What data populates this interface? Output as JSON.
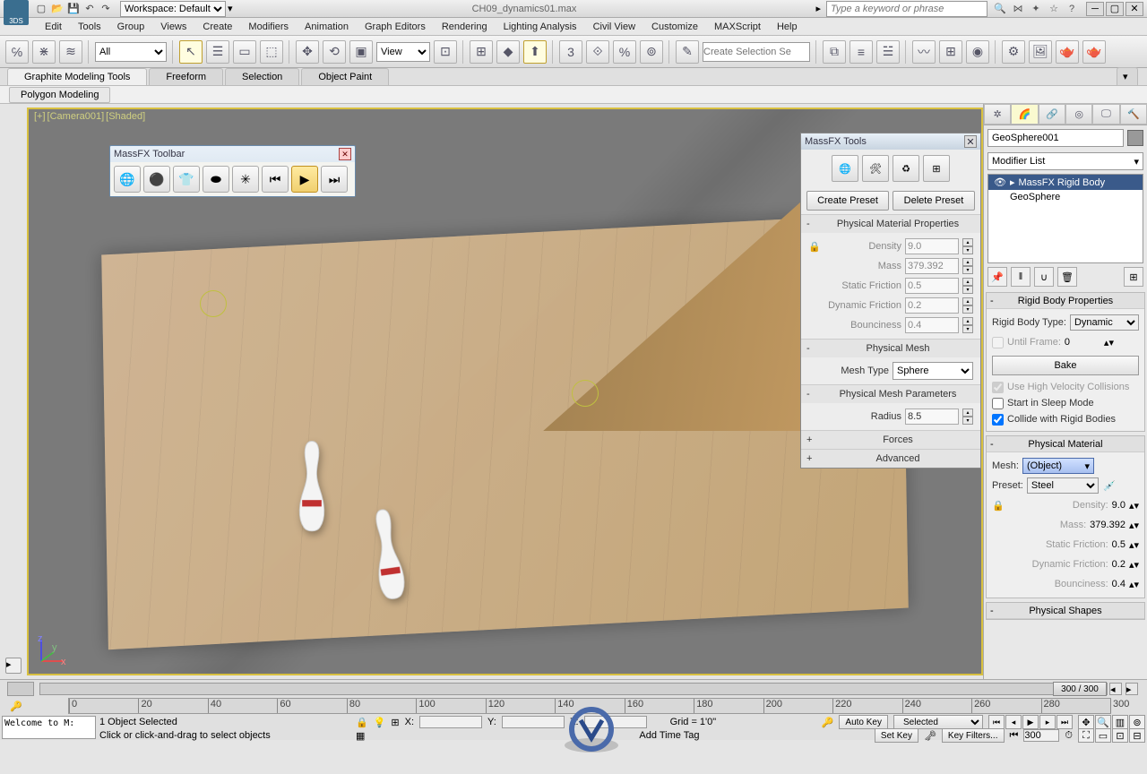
{
  "title": "CH09_dynamics01.max",
  "workspace_label": "Workspace: Default",
  "search_placeholder": "Type a keyword or phrase",
  "menu": [
    "Edit",
    "Tools",
    "Group",
    "Views",
    "Create",
    "Modifiers",
    "Animation",
    "Graph Editors",
    "Rendering",
    "Lighting Analysis",
    "Civil View",
    "Customize",
    "MAXScript",
    "Help"
  ],
  "toolbar": {
    "filter_dd": "All",
    "refsys_dd": "View",
    "selset_placeholder": "Create Selection Se"
  },
  "ribbon_tabs": [
    "Graphite Modeling Tools",
    "Freeform",
    "Selection",
    "Object Paint"
  ],
  "ribbon_sub": "Polygon Modeling",
  "viewport_label": [
    "[+]",
    "[Camera001]",
    "[Shaded]"
  ],
  "fx_toolbar_title": "MassFX Toolbar",
  "fx_panel": {
    "title": "MassFX Tools",
    "create_preset": "Create Preset",
    "delete_preset": "Delete Preset",
    "sec_pmp": "Physical Material Properties",
    "density_l": "Density",
    "density_v": "9.0",
    "mass_l": "Mass",
    "mass_v": "379.392",
    "sfric_l": "Static Friction",
    "sfric_v": "0.5",
    "dfric_l": "Dynamic Friction",
    "dfric_v": "0.2",
    "bounce_l": "Bounciness",
    "bounce_v": "0.4",
    "sec_pm": "Physical Mesh",
    "meshtype_l": "Mesh Type",
    "meshtype_v": "Sphere",
    "sec_pmparam": "Physical Mesh Parameters",
    "radius_l": "Radius",
    "radius_v": "8.5",
    "sec_forces": "Forces",
    "sec_adv": "Advanced"
  },
  "cmd": {
    "obj_name": "GeoSphere001",
    "modlist": "Modifier List",
    "stack": [
      "MassFX Rigid Body",
      "GeoSphere"
    ],
    "ru_rbp": "Rigid Body Properties",
    "rbtype_l": "Rigid Body Type:",
    "rbtype_v": "Dynamic",
    "until_l": "Until Frame:",
    "until_v": "0",
    "bake": "Bake",
    "chk_hv": "Use High Velocity Collisions",
    "chk_sleep": "Start in Sleep Mode",
    "chk_collide": "Collide with Rigid Bodies",
    "ru_pm": "Physical Material",
    "mesh_l": "Mesh:",
    "mesh_v": "(Object)",
    "preset_l": "Preset:",
    "preset_v": "Steel",
    "density_l": "Density:",
    "density_v": "9.0",
    "mass_l": "Mass:",
    "mass_v": "379.392",
    "sfric_l": "Static Friction:",
    "sfric_v": "0.5",
    "dfric_l": "Dynamic Friction:",
    "dfric_v": "0.2",
    "bounce_l": "Bounciness:",
    "bounce_v": "0.4",
    "ru_ps": "Physical Shapes"
  },
  "timeline": {
    "frame_label": "300 / 300",
    "ticks": [
      0,
      20,
      40,
      60,
      80,
      100,
      120,
      140,
      160,
      180,
      200,
      220,
      240,
      260,
      280,
      300
    ]
  },
  "status": {
    "welcome": "Welcome to M:",
    "sel": "1 Object Selected",
    "hint": "Click or click-and-drag to select objects",
    "x": "X:",
    "y": "Y:",
    "z": "Z:",
    "grid": "Grid = 1'0\"",
    "addtag": "Add Time Tag",
    "autokey": "Auto Key",
    "setkey": "Set Key",
    "selected": "Selected",
    "keyfilters": "Key Filters...",
    "frame": "300"
  }
}
